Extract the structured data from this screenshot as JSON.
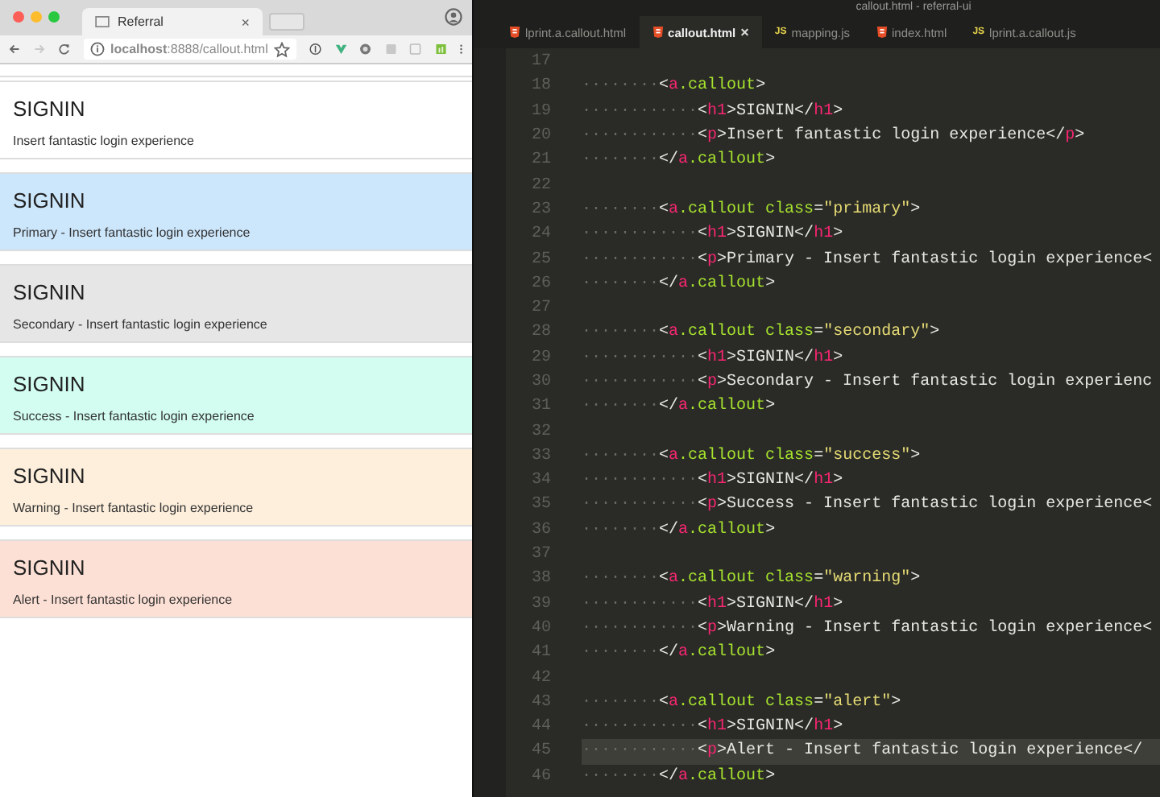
{
  "browser": {
    "tab": {
      "title": "Referral",
      "close": "×"
    },
    "address": "**localhost**:8888/callout.html",
    "callouts": [
      {
        "kind": "default",
        "title": "SIGNIN",
        "text": "Insert fantastic login experience"
      },
      {
        "kind": "primary",
        "title": "SIGNIN",
        "text": "Primary - Insert fantastic login experience"
      },
      {
        "kind": "secondary",
        "title": "SIGNIN",
        "text": "Secondary - Insert fantastic login experience"
      },
      {
        "kind": "success",
        "title": "SIGNIN",
        "text": "Success - Insert fantastic login experience"
      },
      {
        "kind": "warning",
        "title": "SIGNIN",
        "text": "Warning - Insert fantastic login experience"
      },
      {
        "kind": "alert",
        "title": "SIGNIN",
        "text": "Alert - Insert fantastic login experience"
      }
    ]
  },
  "editor": {
    "title": "callout.html - referral-ui",
    "tabs": [
      {
        "kind": "html",
        "label": "lprint.a.callout.html",
        "selected": false
      },
      {
        "kind": "html",
        "label": "callout.html",
        "selected": true,
        "close": "×"
      },
      {
        "kind": "js",
        "icon": "JS",
        "label": "mapping.js",
        "selected": false
      },
      {
        "kind": "html",
        "label": "index.html",
        "selected": false
      },
      {
        "kind": "js",
        "icon": "JS",
        "label": "lprint.a.callout.js",
        "selected": false
      }
    ],
    "lines": [
      {
        "number": "17",
        "current": false
      },
      {
        "number": "18",
        "current": false,
        "tokens": [
          {
            "kind": "ws",
            "text": "········"
          },
          {
            "kind": "punct",
            "text": "<"
          },
          {
            "kind": "tag",
            "text": "a"
          },
          {
            "kind": "cls",
            "text": ".callout"
          },
          {
            "kind": "punct",
            "text": ">"
          }
        ]
      },
      {
        "number": "19",
        "current": false,
        "tokens": [
          {
            "kind": "ws",
            "text": "············"
          },
          {
            "kind": "punct",
            "text": "<"
          },
          {
            "kind": "tag",
            "text": "h1"
          },
          {
            "kind": "punct",
            "text": ">SIGNIN</"
          },
          {
            "kind": "tag",
            "text": "h1"
          },
          {
            "kind": "punct",
            "text": ">"
          }
        ]
      },
      {
        "number": "20",
        "current": false,
        "tokens": [
          {
            "kind": "ws",
            "text": "············"
          },
          {
            "kind": "punct",
            "text": "<"
          },
          {
            "kind": "tag",
            "text": "p"
          },
          {
            "kind": "punct",
            "text": ">Insert fantastic login experience</"
          },
          {
            "kind": "tag",
            "text": "p"
          },
          {
            "kind": "punct",
            "text": ">"
          }
        ]
      },
      {
        "number": "21",
        "current": false,
        "tokens": [
          {
            "kind": "ws",
            "text": "········"
          },
          {
            "kind": "punct",
            "text": "</"
          },
          {
            "kind": "tag",
            "text": "a"
          },
          {
            "kind": "cls",
            "text": ".callout"
          },
          {
            "kind": "punct",
            "text": ">"
          }
        ]
      },
      {
        "number": "22",
        "current": false
      },
      {
        "number": "23",
        "current": false,
        "tokens": [
          {
            "kind": "ws",
            "text": "········"
          },
          {
            "kind": "punct",
            "text": "<"
          },
          {
            "kind": "tag",
            "text": "a"
          },
          {
            "kind": "cls",
            "text": ".callout class"
          },
          {
            "kind": "punct",
            "text": "="
          },
          {
            "kind": "str",
            "text": "\"primary\""
          },
          {
            "kind": "punct",
            "text": ">"
          }
        ]
      },
      {
        "number": "24",
        "current": false,
        "tokens": [
          {
            "kind": "ws",
            "text": "············"
          },
          {
            "kind": "punct",
            "text": "<"
          },
          {
            "kind": "tag",
            "text": "h1"
          },
          {
            "kind": "punct",
            "text": ">SIGNIN</"
          },
          {
            "kind": "tag",
            "text": "h1"
          },
          {
            "kind": "punct",
            "text": ">"
          }
        ]
      },
      {
        "number": "25",
        "current": false,
        "tokens": [
          {
            "kind": "ws",
            "text": "············"
          },
          {
            "kind": "punct",
            "text": "<"
          },
          {
            "kind": "tag",
            "text": "p"
          },
          {
            "kind": "punct",
            "text": ">Primary - Insert fantastic login experience<"
          }
        ]
      },
      {
        "number": "26",
        "current": false,
        "tokens": [
          {
            "kind": "ws",
            "text": "········"
          },
          {
            "kind": "punct",
            "text": "</"
          },
          {
            "kind": "tag",
            "text": "a"
          },
          {
            "kind": "cls",
            "text": ".callout"
          },
          {
            "kind": "punct",
            "text": ">"
          }
        ]
      },
      {
        "number": "27",
        "current": false
      },
      {
        "number": "28",
        "current": false,
        "tokens": [
          {
            "kind": "ws",
            "text": "········"
          },
          {
            "kind": "punct",
            "text": "<"
          },
          {
            "kind": "tag",
            "text": "a"
          },
          {
            "kind": "cls",
            "text": ".callout class"
          },
          {
            "kind": "punct",
            "text": "="
          },
          {
            "kind": "str",
            "text": "\"secondary\""
          },
          {
            "kind": "punct",
            "text": ">"
          }
        ]
      },
      {
        "number": "29",
        "current": false,
        "tokens": [
          {
            "kind": "ws",
            "text": "············"
          },
          {
            "kind": "punct",
            "text": "<"
          },
          {
            "kind": "tag",
            "text": "h1"
          },
          {
            "kind": "punct",
            "text": ">SIGNIN</"
          },
          {
            "kind": "tag",
            "text": "h1"
          },
          {
            "kind": "punct",
            "text": ">"
          }
        ]
      },
      {
        "number": "30",
        "current": false,
        "tokens": [
          {
            "kind": "ws",
            "text": "············"
          },
          {
            "kind": "punct",
            "text": "<"
          },
          {
            "kind": "tag",
            "text": "p"
          },
          {
            "kind": "punct",
            "text": ">Secondary - Insert fantastic login experienc"
          }
        ]
      },
      {
        "number": "31",
        "current": false,
        "tokens": [
          {
            "kind": "ws",
            "text": "········"
          },
          {
            "kind": "punct",
            "text": "</"
          },
          {
            "kind": "tag",
            "text": "a"
          },
          {
            "kind": "cls",
            "text": ".callout"
          },
          {
            "kind": "punct",
            "text": ">"
          }
        ]
      },
      {
        "number": "32",
        "current": false
      },
      {
        "number": "33",
        "current": false,
        "tokens": [
          {
            "kind": "ws",
            "text": "········"
          },
          {
            "kind": "punct",
            "text": "<"
          },
          {
            "kind": "tag",
            "text": "a"
          },
          {
            "kind": "cls",
            "text": ".callout class"
          },
          {
            "kind": "punct",
            "text": "="
          },
          {
            "kind": "str",
            "text": "\"success\""
          },
          {
            "kind": "punct",
            "text": ">"
          }
        ]
      },
      {
        "number": "34",
        "current": false,
        "tokens": [
          {
            "kind": "ws",
            "text": "············"
          },
          {
            "kind": "punct",
            "text": "<"
          },
          {
            "kind": "tag",
            "text": "h1"
          },
          {
            "kind": "punct",
            "text": ">SIGNIN</"
          },
          {
            "kind": "tag",
            "text": "h1"
          },
          {
            "kind": "punct",
            "text": ">"
          }
        ]
      },
      {
        "number": "35",
        "current": false,
        "tokens": [
          {
            "kind": "ws",
            "text": "············"
          },
          {
            "kind": "punct",
            "text": "<"
          },
          {
            "kind": "tag",
            "text": "p"
          },
          {
            "kind": "punct",
            "text": ">Success - Insert fantastic login experience<"
          }
        ]
      },
      {
        "number": "36",
        "current": false,
        "tokens": [
          {
            "kind": "ws",
            "text": "········"
          },
          {
            "kind": "punct",
            "text": "</"
          },
          {
            "kind": "tag",
            "text": "a"
          },
          {
            "kind": "cls",
            "text": ".callout"
          },
          {
            "kind": "punct",
            "text": ">"
          }
        ]
      },
      {
        "number": "37",
        "current": false
      },
      {
        "number": "38",
        "current": false,
        "tokens": [
          {
            "kind": "ws",
            "text": "········"
          },
          {
            "kind": "punct",
            "text": "<"
          },
          {
            "kind": "tag",
            "text": "a"
          },
          {
            "kind": "cls",
            "text": ".callout class"
          },
          {
            "kind": "punct",
            "text": "="
          },
          {
            "kind": "str",
            "text": "\"warning\""
          },
          {
            "kind": "punct",
            "text": ">"
          }
        ]
      },
      {
        "number": "39",
        "current": false,
        "tokens": [
          {
            "kind": "ws",
            "text": "············"
          },
          {
            "kind": "punct",
            "text": "<"
          },
          {
            "kind": "tag",
            "text": "h1"
          },
          {
            "kind": "punct",
            "text": ">SIGNIN</"
          },
          {
            "kind": "tag",
            "text": "h1"
          },
          {
            "kind": "punct",
            "text": ">"
          }
        ]
      },
      {
        "number": "40",
        "current": false,
        "tokens": [
          {
            "kind": "ws",
            "text": "············"
          },
          {
            "kind": "punct",
            "text": "<"
          },
          {
            "kind": "tag",
            "text": "p"
          },
          {
            "kind": "punct",
            "text": ">Warning - Insert fantastic login experience<"
          }
        ]
      },
      {
        "number": "41",
        "current": false,
        "tokens": [
          {
            "kind": "ws",
            "text": "········"
          },
          {
            "kind": "punct",
            "text": "</"
          },
          {
            "kind": "tag",
            "text": "a"
          },
          {
            "kind": "cls",
            "text": ".callout"
          },
          {
            "kind": "punct",
            "text": ">"
          }
        ]
      },
      {
        "number": "42",
        "current": false
      },
      {
        "number": "43",
        "current": false,
        "tokens": [
          {
            "kind": "ws",
            "text": "········"
          },
          {
            "kind": "punct",
            "text": "<"
          },
          {
            "kind": "tag",
            "text": "a"
          },
          {
            "kind": "cls",
            "text": ".callout class"
          },
          {
            "kind": "punct",
            "text": "="
          },
          {
            "kind": "str",
            "text": "\"alert\""
          },
          {
            "kind": "punct",
            "text": ">"
          }
        ]
      },
      {
        "number": "44",
        "current": false,
        "tokens": [
          {
            "kind": "ws",
            "text": "············"
          },
          {
            "kind": "punct",
            "text": "<"
          },
          {
            "kind": "tag",
            "text": "h1"
          },
          {
            "kind": "punct",
            "text": ">SIGNIN</"
          },
          {
            "kind": "tag",
            "text": "h1"
          },
          {
            "kind": "punct",
            "text": ">"
          }
        ]
      },
      {
        "number": "45",
        "current": true,
        "tokens": [
          {
            "kind": "ws",
            "text": "············"
          },
          {
            "kind": "punct",
            "text": "<"
          },
          {
            "kind": "tag",
            "text": "p"
          },
          {
            "kind": "punct",
            "text": ">Alert - Insert fantastic login experience</"
          }
        ]
      },
      {
        "number": "46",
        "current": false,
        "tokens": [
          {
            "kind": "ws",
            "text": "········"
          },
          {
            "kind": "punct",
            "text": "</"
          },
          {
            "kind": "tag",
            "text": "a"
          },
          {
            "kind": "cls",
            "text": ".callout"
          },
          {
            "kind": "punct",
            "text": ">"
          }
        ]
      }
    ]
  }
}
